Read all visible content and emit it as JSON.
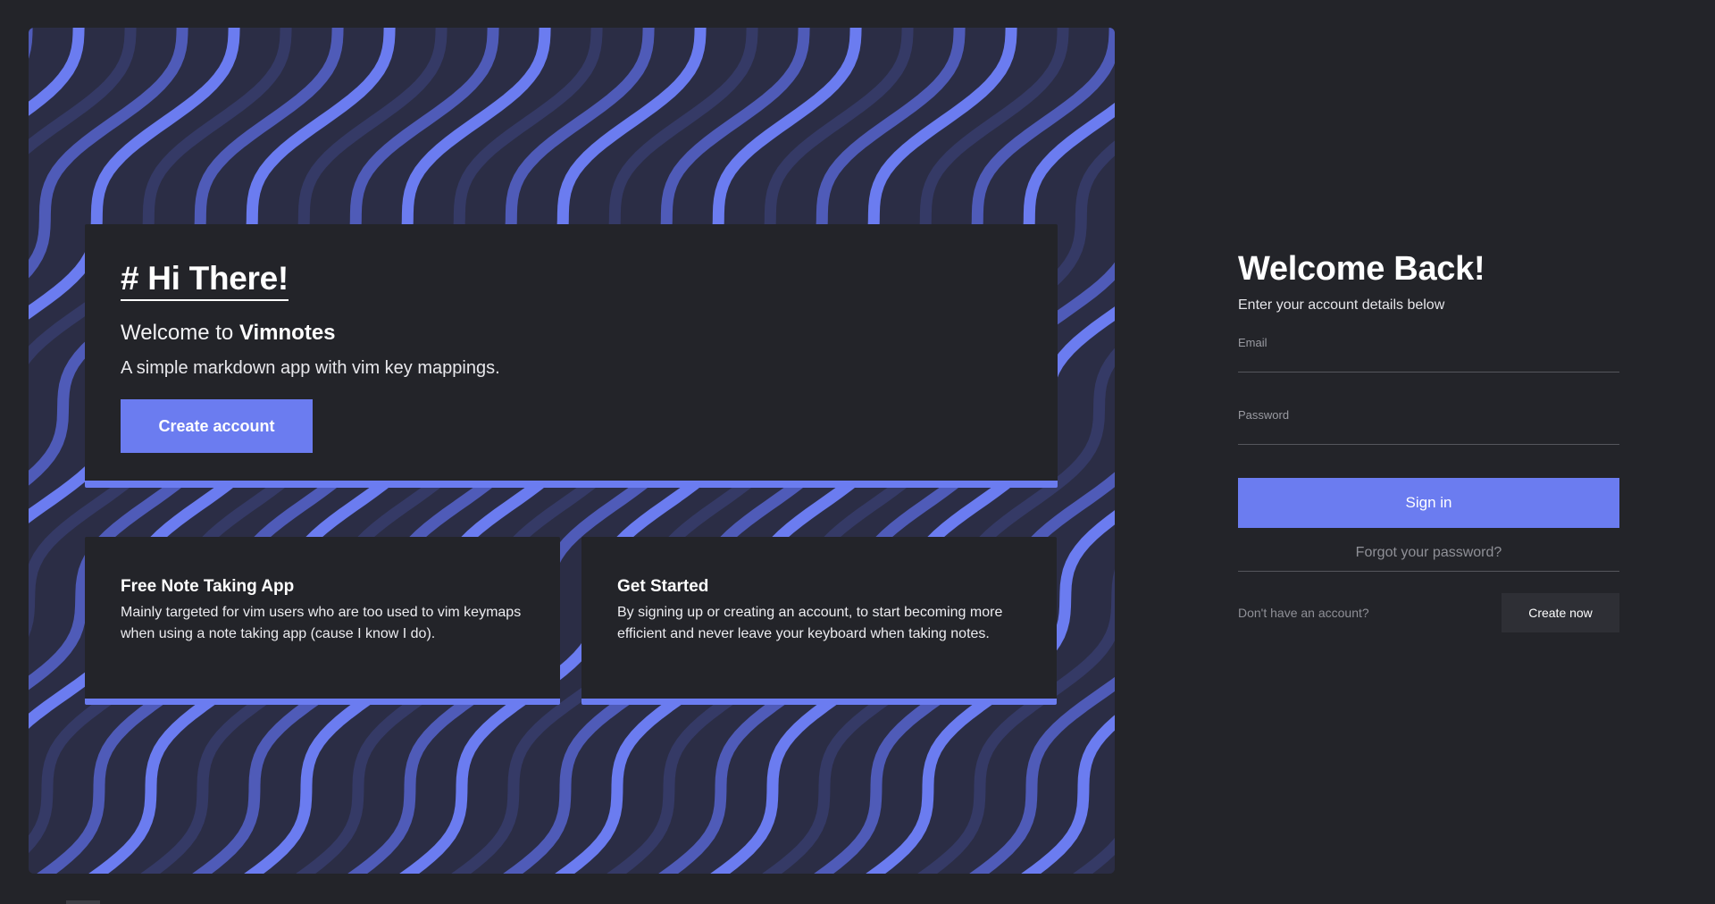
{
  "hero": {
    "heading": "# Hi There!",
    "welcome_prefix": "Welcome to ",
    "app_name": "Vimnotes",
    "tagline": "A simple markdown app with vim key mappings.",
    "create_account_label": "Create account",
    "cards": [
      {
        "title": "Free Note Taking App",
        "body": "Mainly targeted for vim users who are too used to vim keymaps when using a note taking app (cause I know I do)."
      },
      {
        "title": "Get Started",
        "body": "By signing up or creating an account, to start becoming more efficient and never leave your keyboard when taking notes."
      }
    ]
  },
  "signin": {
    "title": "Welcome Back!",
    "subtitle": "Enter your account details below",
    "email_label": "Email",
    "email_value": "",
    "password_label": "Password",
    "password_value": "",
    "submit_label": "Sign in",
    "forgot_label": "Forgot your password?",
    "no_account_text": "Don't have an account?",
    "create_now_label": "Create now"
  },
  "colors": {
    "background": "#232429",
    "accent": "#6b7cf0",
    "pattern_base": "#2b2d45",
    "wave_light": "#6b7cf0",
    "wave_mid": "#4f5bb8",
    "wave_dark": "#353a66"
  }
}
